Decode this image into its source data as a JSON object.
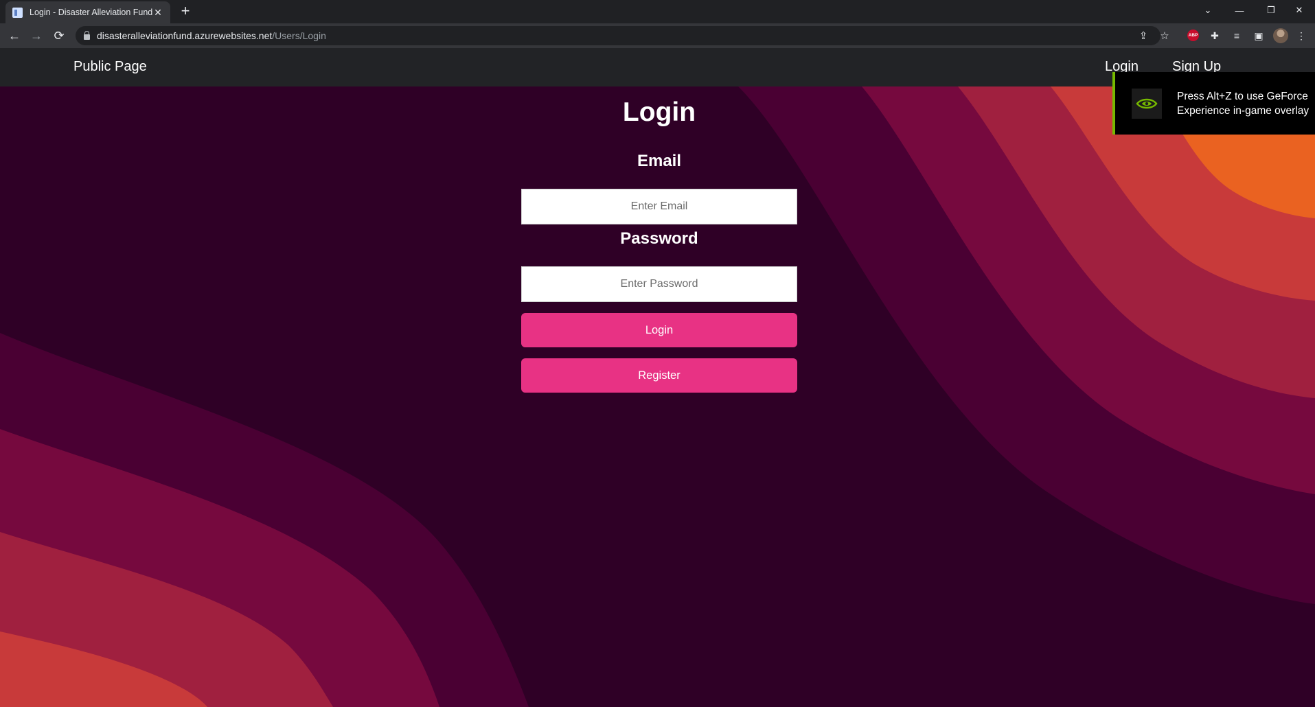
{
  "browser": {
    "tab_title": "Login - Disaster Alleviation Fund",
    "url_host": "disasteralleviationfund.azurewebsites.net",
    "url_path": "/Users/Login",
    "extension_abp_label": "ABP"
  },
  "nav": {
    "brand": "Public Page",
    "login": "Login",
    "signup": "Sign Up"
  },
  "form": {
    "title": "Login",
    "email_label": "Email",
    "email_placeholder": "Enter Email",
    "email_value": "",
    "password_label": "Password",
    "password_placeholder": "Enter Password",
    "password_value": "",
    "login_button": "Login",
    "register_button": "Register"
  },
  "overlay": {
    "text": "Press Alt+Z to use GeForce Experience in-game overlay"
  },
  "colors": {
    "page_bg": "#2f0026",
    "nav_bg": "#222326",
    "button": "#e83284",
    "wave_1": "#4a0033",
    "wave_2": "#76093e",
    "wave_3": "#a0203f",
    "wave_4": "#c83a3a",
    "wave_5": "#ea6221",
    "nvidia_green": "#76b900"
  }
}
